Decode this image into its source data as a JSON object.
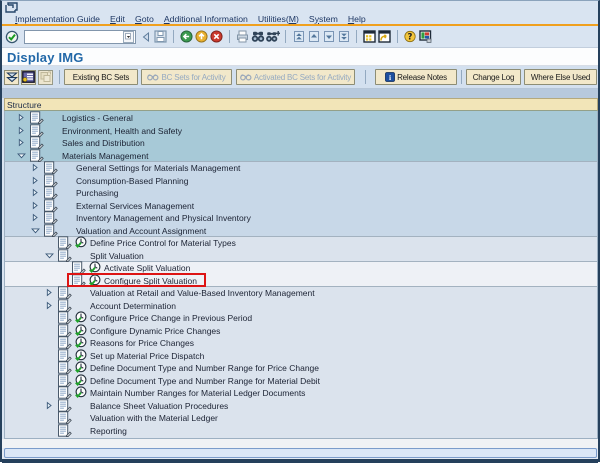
{
  "title": "Display IMG",
  "menu_bar": {
    "items": [
      {
        "label": "Implementation Guide",
        "underline": 0
      },
      {
        "label": "Edit",
        "underline": 0
      },
      {
        "label": "Goto",
        "underline": 0
      },
      {
        "label": "Additional Information",
        "underline": 0
      },
      {
        "label": "Utilities(M)",
        "underline": 10
      },
      {
        "label": "System",
        "underline": 1
      },
      {
        "label": "Help",
        "underline": 0
      }
    ]
  },
  "toolbar": {
    "command_field": {
      "value": "",
      "placeholder": ""
    },
    "items": [
      {
        "icon": "enter"
      },
      {
        "field": true
      },
      {
        "icon": "collapse-field"
      },
      {
        "icon": "save"
      },
      {
        "sep": true
      },
      {
        "icon": "back"
      },
      {
        "icon": "exit"
      },
      {
        "icon": "cancel"
      },
      {
        "sep": true
      },
      {
        "icon": "print"
      },
      {
        "icon": "find"
      },
      {
        "icon": "find-next"
      },
      {
        "sep": true
      },
      {
        "icon": "first-page"
      },
      {
        "icon": "previous-page"
      },
      {
        "icon": "next-page"
      },
      {
        "icon": "last-page"
      },
      {
        "sep": true
      },
      {
        "icon": "new-session"
      },
      {
        "icon": "create-shortcut"
      },
      {
        "sep": true
      },
      {
        "icon": "help"
      },
      {
        "icon": "customize-layout"
      }
    ]
  },
  "app_toolbar": {
    "icon_buttons": [
      {
        "icon": "position",
        "disabled": false
      },
      {
        "icon": "img-information",
        "disabled": false
      },
      {
        "icon": "copy",
        "disabled": true
      }
    ],
    "buttons": [
      {
        "label": "Existing BC Sets",
        "icon": null,
        "disabled": false
      },
      {
        "label": "BC Sets for Activity",
        "icon": "bc-set-glasses",
        "disabled": true
      },
      {
        "label": "Activated BC Sets for Activity",
        "icon": "bc-set-glasses",
        "disabled": true
      },
      {
        "label": "Release Notes",
        "icon": "info",
        "disabled": false
      },
      {
        "label": "Change Log",
        "icon": null,
        "disabled": false
      },
      {
        "label": "Where Else Used",
        "icon": null,
        "disabled": false
      }
    ]
  },
  "tree": {
    "header": "Structure",
    "rows": [
      {
        "label": "Logistics - General",
        "level": 1,
        "expander": "collapsed",
        "type": "folder",
        "highlighted": false
      },
      {
        "label": "Environment, Health and Safety",
        "level": 1,
        "expander": "collapsed",
        "type": "folder",
        "highlighted": false
      },
      {
        "label": "Sales and Distribution",
        "level": 1,
        "expander": "collapsed",
        "type": "folder",
        "highlighted": false
      },
      {
        "label": "Materials Management",
        "level": 1,
        "expander": "expanded",
        "type": "folder",
        "highlighted": false
      },
      {
        "label": "General Settings for Materials Management",
        "level": 2,
        "expander": "collapsed",
        "type": "folder",
        "highlighted": false
      },
      {
        "label": "Consumption-Based Planning",
        "level": 2,
        "expander": "collapsed",
        "type": "folder",
        "highlighted": false
      },
      {
        "label": "Purchasing",
        "level": 2,
        "expander": "collapsed",
        "type": "folder",
        "highlighted": false
      },
      {
        "label": "External Services Management",
        "level": 2,
        "expander": "collapsed",
        "type": "folder",
        "highlighted": false
      },
      {
        "label": "Inventory Management and Physical Inventory",
        "level": 2,
        "expander": "collapsed",
        "type": "folder",
        "highlighted": false
      },
      {
        "label": "Valuation and Account Assignment",
        "level": 2,
        "expander": "expanded",
        "type": "folder",
        "highlighted": false
      },
      {
        "label": "Define Price Control for Material Types",
        "level": 3,
        "expander": "none",
        "type": "activity",
        "highlighted": false
      },
      {
        "label": "Split Valuation",
        "level": 3,
        "expander": "expanded",
        "type": "folder",
        "highlighted": false
      },
      {
        "label": "Activate Split Valuation",
        "level": 4,
        "expander": "none",
        "type": "activity",
        "highlighted": false
      },
      {
        "label": "Configure Split Valuation",
        "level": 4,
        "expander": "none",
        "type": "activity",
        "highlighted": true
      },
      {
        "label": "Valuation at Retail and Value-Based Inventory Management",
        "level": 3,
        "expander": "collapsed",
        "type": "folder",
        "highlighted": false
      },
      {
        "label": "Account Determination",
        "level": 3,
        "expander": "collapsed",
        "type": "folder",
        "highlighted": false
      },
      {
        "label": "Configure Price Change in Previous Period",
        "level": 3,
        "expander": "none",
        "type": "activity",
        "highlighted": false
      },
      {
        "label": "Configure Dynamic Price Changes",
        "level": 3,
        "expander": "none",
        "type": "activity",
        "highlighted": false
      },
      {
        "label": "Reasons for Price Changes",
        "level": 3,
        "expander": "none",
        "type": "activity",
        "highlighted": false
      },
      {
        "label": "Set up Material Price Dispatch",
        "level": 3,
        "expander": "none",
        "type": "activity",
        "highlighted": false
      },
      {
        "label": "Define Document Type and Number Range for Price Change",
        "level": 3,
        "expander": "none",
        "type": "activity",
        "highlighted": false
      },
      {
        "label": "Define Document Type and Number Range for Material Debit",
        "level": 3,
        "expander": "none",
        "type": "activity",
        "highlighted": false
      },
      {
        "label": "Maintain Number Ranges for Material Ledger Documents",
        "level": 3,
        "expander": "none",
        "type": "activity",
        "highlighted": false
      },
      {
        "label": "Balance Sheet Valuation Procedures",
        "level": 3,
        "expander": "collapsed",
        "type": "folder",
        "highlighted": false
      },
      {
        "label": "Valuation with the Material Ledger",
        "level": 3,
        "expander": "none",
        "type": "folder",
        "highlighted": false
      },
      {
        "label": "Reporting",
        "level": 3,
        "expander": "none",
        "type": "folder",
        "highlighted": false
      }
    ]
  },
  "status_bar": {
    "message": ""
  },
  "colors": {
    "accent_orange": "#f0a01e",
    "title_blue": "#2268a8",
    "band_level1": "#a7c9d7",
    "band_level2": "#c8d8e8",
    "band_level3": "#dbe3ed",
    "band_level4": "#eef1f6",
    "button_tan": "#f2e8ca",
    "highlight_red": "#dd1414"
  }
}
